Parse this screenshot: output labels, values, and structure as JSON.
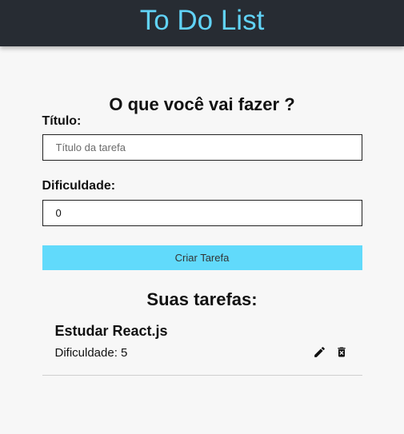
{
  "header": {
    "title": "To Do List"
  },
  "form": {
    "heading": "O que você vai fazer ?",
    "title_label": "Título:",
    "title_placeholder": "Título da tarefa",
    "title_value": "",
    "difficulty_label": "Dificuldade:",
    "difficulty_value": "0",
    "submit_label": "Criar Tarefa"
  },
  "tasks": {
    "heading": "Suas tarefas:",
    "items": [
      {
        "name": "Estudar React.js",
        "difficulty_text": "Dificuldade: 5",
        "edit_icon": "pencil-icon",
        "delete_icon": "trash-icon"
      }
    ]
  },
  "colors": {
    "header_bg": "#272c33",
    "accent": "#61dafb",
    "page_bg": "#f7f7f7"
  }
}
